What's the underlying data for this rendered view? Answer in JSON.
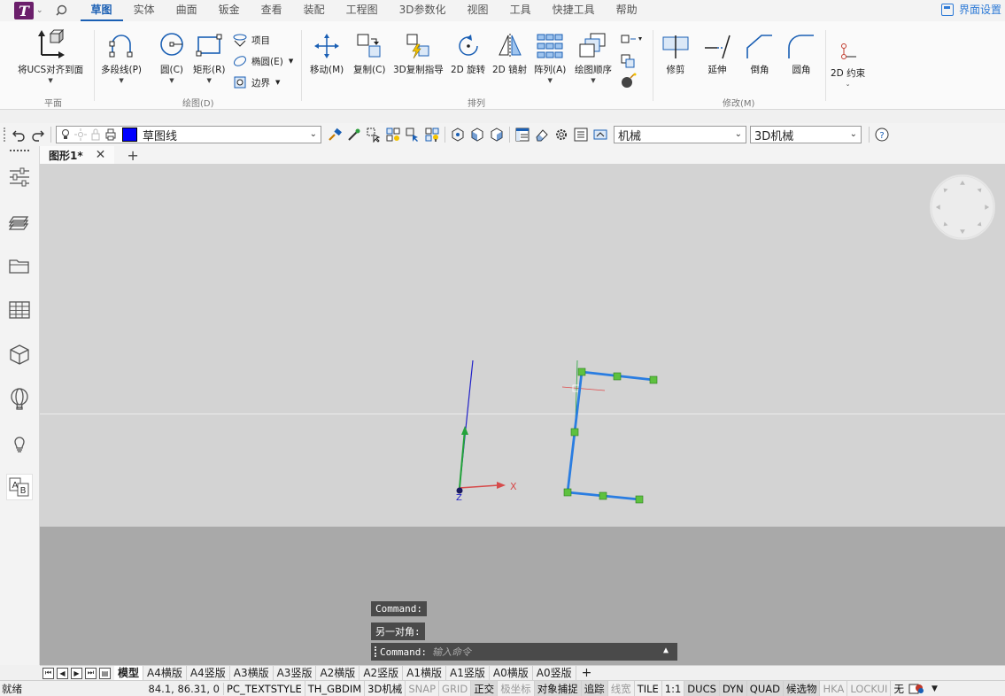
{
  "menu": {
    "tabs": [
      {
        "label": "草图",
        "active": true
      },
      {
        "label": "实体"
      },
      {
        "label": "曲面"
      },
      {
        "label": "钣金"
      },
      {
        "label": "查看"
      },
      {
        "label": "装配"
      },
      {
        "label": "工程图"
      },
      {
        "label": "3D参数化"
      },
      {
        "label": "视图"
      },
      {
        "label": "工具"
      },
      {
        "label": "快捷工具"
      },
      {
        "label": "帮助"
      }
    ],
    "ui_settings": "界面设置"
  },
  "ribbon": {
    "align_ucs": "将UCS对齐到面",
    "polyline": "多段线(P)",
    "circle": "圆(C)",
    "rectangle": "矩形(R)",
    "project": "项目",
    "ellipse": "椭圆(E)",
    "boundary": "边界",
    "move": "移动(M)",
    "copy": "复制(C)",
    "copy3d": "3D复制指导",
    "rotate2d": "2D 旋转",
    "mirror2d": "2D 镜射",
    "array": "阵列(A)",
    "draworder": "绘图顺序",
    "trim": "修剪",
    "extend": "延伸",
    "chamfer": "倒角",
    "fillet": "圆角",
    "constraint2d": "2D 约束",
    "groups": {
      "plane": "平面",
      "draw": "绘图(D)",
      "arrange": "排列",
      "modify": "修改(M)"
    }
  },
  "toolbar": {
    "layer_name": "草图线",
    "layer_color": "#0000ff",
    "text_style": "机械",
    "dim_standard": "3D机械"
  },
  "document": {
    "tab_title": "图形1*"
  },
  "command": {
    "history": [
      "Command:",
      "另一对角:"
    ],
    "prompt": "Command:",
    "placeholder": "输入命令"
  },
  "layout_tabs": [
    "模型",
    "A4横版",
    "A4竖版",
    "A3横版",
    "A3竖版",
    "A2横版",
    "A2竖版",
    "A1横版",
    "A1竖版",
    "A0横版",
    "A0竖版"
  ],
  "status": {
    "ready": "就绪",
    "coords": "84.1, 86.31, 0",
    "items": [
      {
        "label": "PC_TEXTSTYLE",
        "state": "plain"
      },
      {
        "label": "TH_GBDIM",
        "state": "plain"
      },
      {
        "label": "3D机械",
        "state": "plain"
      },
      {
        "label": "SNAP",
        "state": "off"
      },
      {
        "label": "GRID",
        "state": "off"
      },
      {
        "label": "正交",
        "state": "on"
      },
      {
        "label": "极坐标",
        "state": "off"
      },
      {
        "label": "对象捕捉",
        "state": "on"
      },
      {
        "label": "追踪",
        "state": "on"
      },
      {
        "label": "线宽",
        "state": "off"
      },
      {
        "label": "TILE",
        "state": "plain"
      },
      {
        "label": "1:1",
        "state": "plain"
      },
      {
        "label": "DUCS",
        "state": "on"
      },
      {
        "label": "DYN",
        "state": "on"
      },
      {
        "label": "QUAD",
        "state": "on"
      },
      {
        "label": "候选物",
        "state": "on"
      },
      {
        "label": "HKA",
        "state": "off"
      },
      {
        "label": "LOCKUI",
        "state": "off"
      },
      {
        "label": "无",
        "state": "plain"
      }
    ]
  },
  "canvas": {
    "axis_z_label": "Z",
    "axis_x_label": "X"
  }
}
